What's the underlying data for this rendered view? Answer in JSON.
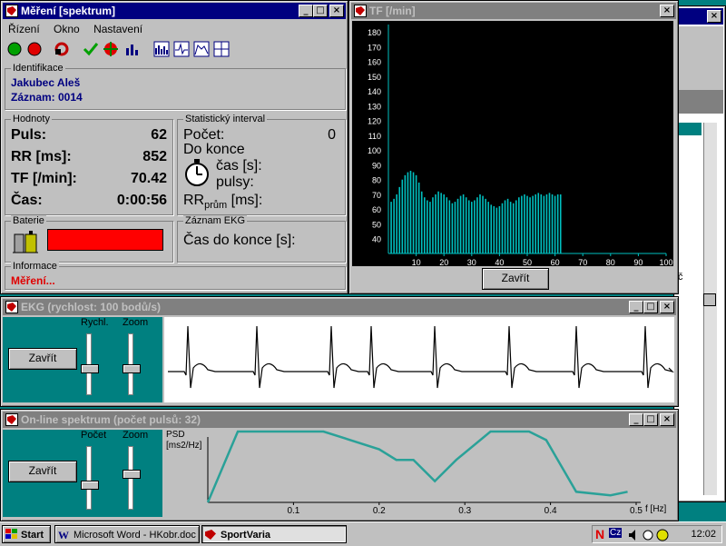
{
  "measure": {
    "title": "Měření [spektrum]",
    "menu": [
      "Řízení",
      "Okno",
      "Nastavení"
    ],
    "ident": {
      "label": "Identifikace",
      "name": "Jakubec Aleš",
      "record": "Záznam: 0014"
    },
    "values": {
      "label": "Hodnoty",
      "rows": [
        {
          "label": "Puls:",
          "value": "62"
        },
        {
          "label": "RR [ms]:",
          "value": "852"
        },
        {
          "label": "TF [/min]:",
          "value": "70.42"
        },
        {
          "label": "Čas:",
          "value": "0:00:56"
        }
      ]
    },
    "stat": {
      "label": "Statistický interval",
      "count_label": "Počet:",
      "count_value": "0",
      "remaining": "Do konce",
      "time": "čas [s]:",
      "pulses": "pulsy:",
      "rr": "RR",
      "rr_sub": "prům",
      "rr_unit": "[ms]:"
    },
    "battery": {
      "label": "Baterie",
      "color": "#ff0000"
    },
    "ekg_rec": {
      "label": "Záznam EKG",
      "text": "Čas do konce [s]:"
    },
    "info": {
      "label": "Informace",
      "text": "Měření..."
    }
  },
  "tf": {
    "title": "TF [/min]",
    "close": "Zavřít",
    "chart_data": {
      "type": "bar",
      "xlim": [
        0,
        100
      ],
      "ylim": [
        30,
        185
      ],
      "x_ticks": [
        "10",
        "20",
        "30",
        "40",
        "50",
        "60",
        "70",
        "80",
        "90",
        "100"
      ],
      "y_ticks": [
        "40",
        "50",
        "60",
        "70",
        "80",
        "90",
        "100",
        "110",
        "120",
        "130",
        "140",
        "150",
        "160",
        "170",
        "180"
      ],
      "values": [
        65,
        67,
        70,
        75,
        80,
        83,
        85,
        86,
        85,
        83,
        78,
        72,
        68,
        66,
        65,
        68,
        70,
        72,
        71,
        70,
        68,
        66,
        64,
        65,
        67,
        69,
        70,
        68,
        66,
        65,
        66,
        68,
        70,
        69,
        67,
        65,
        63,
        62,
        61,
        62,
        64,
        66,
        67,
        65,
        64,
        66,
        68,
        69,
        70,
        69,
        68,
        69,
        70,
        71,
        70,
        69,
        70,
        71,
        70,
        69,
        70,
        70
      ],
      "bar_color": "#00c0c0",
      "background": "#000000"
    }
  },
  "ekg": {
    "title": "EKG (rychlost: 100 bodů/s)",
    "close": "Zavřít",
    "speed_label": "Rychl.",
    "zoom_label": "Zoom"
  },
  "spectrum": {
    "title": "On-line spektrum (počet pulsů: 32)",
    "close": "Zavřít",
    "count_label": "Počet",
    "zoom_label": "Zoom",
    "chart_data": {
      "type": "line",
      "ylabel": "PSD\n[ms2/Hz]",
      "xlabel": "f [Hz]",
      "x_ticks": [
        "0.1",
        "0.2",
        "0.3",
        "0.4",
        "0.5"
      ],
      "xlim": [
        0,
        0.5
      ],
      "x": [
        0.0,
        0.035,
        0.065,
        0.135,
        0.2,
        0.22,
        0.24,
        0.265,
        0.29,
        0.33,
        0.375,
        0.395,
        0.43,
        0.47,
        0.49
      ],
      "y": [
        0.0,
        1.0,
        1.0,
        1.0,
        0.75,
        0.6,
        0.6,
        0.3,
        0.6,
        1.0,
        1.0,
        0.88,
        0.15,
        0.1,
        0.15
      ],
      "line_color": "#2aa198"
    }
  },
  "taskbar": {
    "start": "Start",
    "items": [
      "Microsoft Word - HKobr.doc",
      "SportVaria"
    ],
    "clock": "12:02",
    "tray": [
      "N",
      "Cz"
    ]
  },
  "back": {
    "text": "č"
  }
}
